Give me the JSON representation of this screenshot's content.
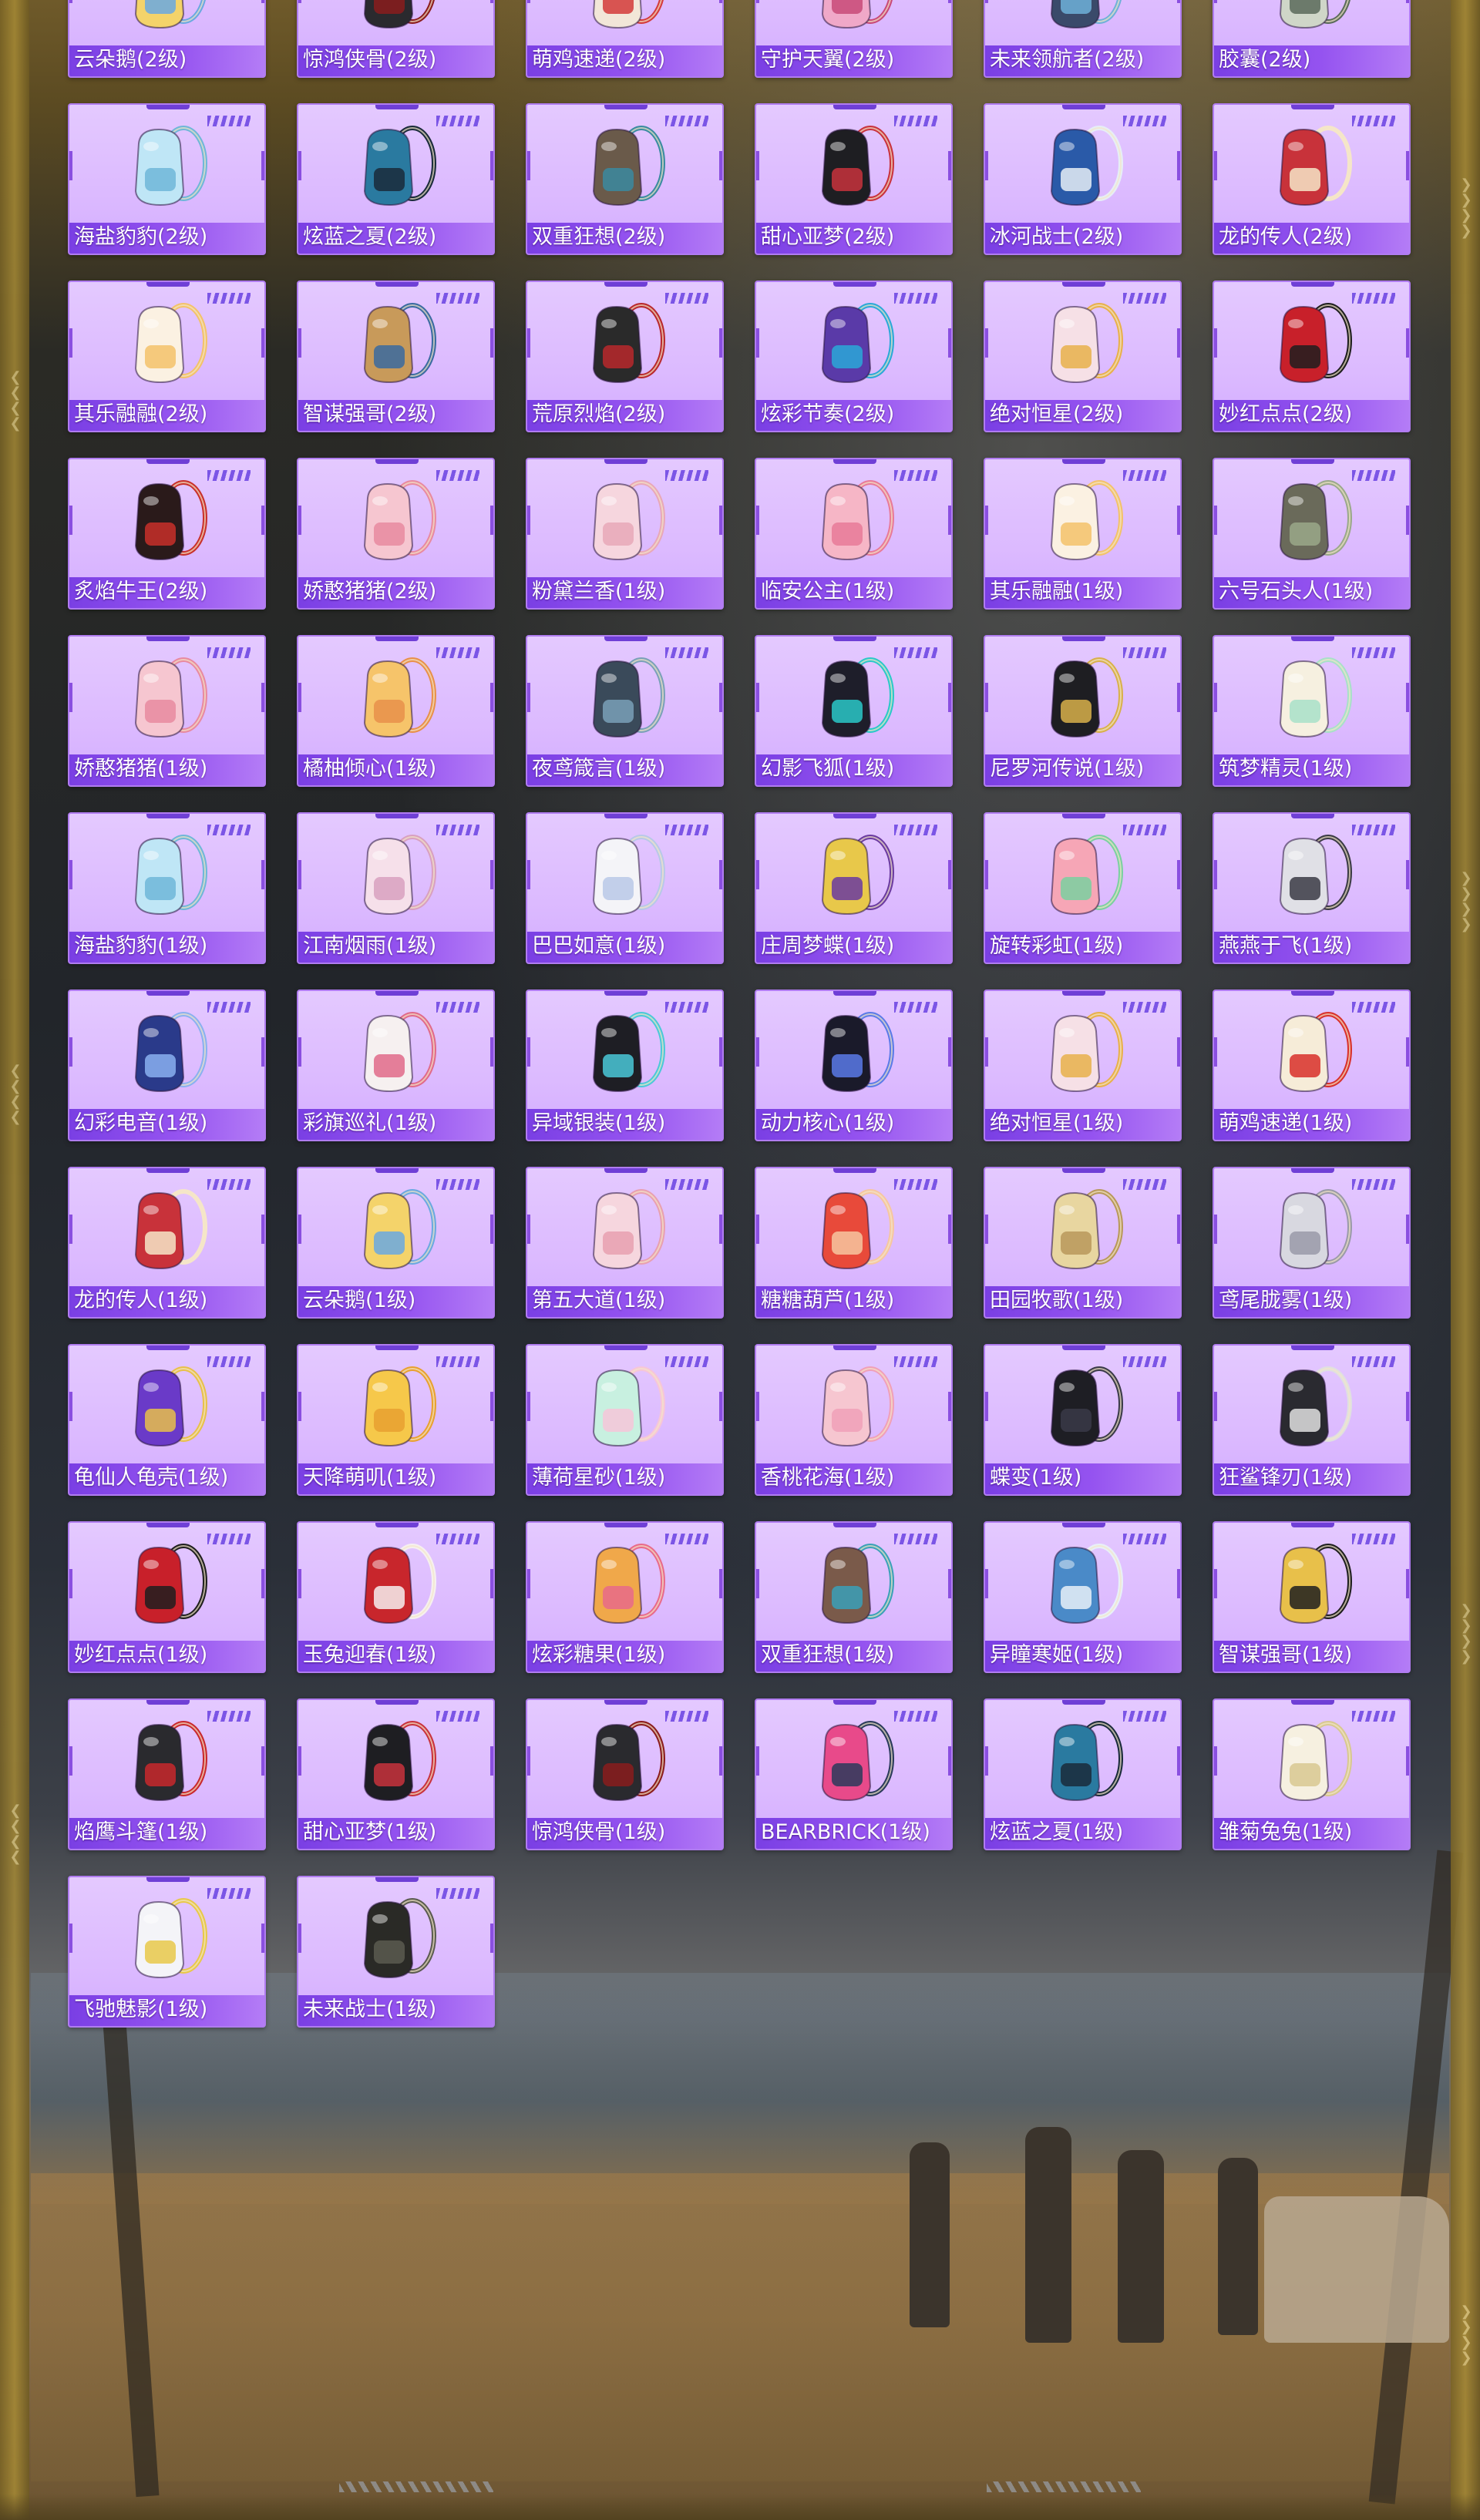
{
  "items": [
    {
      "name": "云朵鹅(2级)",
      "icon": "backpack-icon",
      "colors": [
        "#f4d36a",
        "#6aa8e0"
      ]
    },
    {
      "name": "惊鸿侠骨(2级)",
      "icon": "backpack-icon",
      "colors": [
        "#2a2a2e",
        "#8a1c1c"
      ]
    },
    {
      "name": "萌鸡速递(2级)",
      "icon": "backpack-icon",
      "colors": [
        "#f2e6d8",
        "#d33a3a"
      ]
    },
    {
      "name": "守护天翼(2级)",
      "icon": "backpack-icon",
      "colors": [
        "#f0a8c8",
        "#c84a78"
      ]
    },
    {
      "name": "未来领航者(2级)",
      "icon": "backpack-icon",
      "colors": [
        "#3a4a6a",
        "#6fb0d8"
      ]
    },
    {
      "name": "胶囊(2级)",
      "icon": "backpack-icon",
      "colors": [
        "#cfd6c8",
        "#5a6a5a"
      ]
    },
    {
      "name": "海盐豹豹(2级)",
      "icon": "backpack-icon",
      "colors": [
        "#bfe6f6",
        "#6fb6d8"
      ]
    },
    {
      "name": "炫蓝之夏(2级)",
      "icon": "backpack-icon",
      "colors": [
        "#2a7aa0",
        "#1a2a3a"
      ]
    },
    {
      "name": "双重狂想(2级)",
      "icon": "backpack-icon",
      "colors": [
        "#6a5a4a",
        "#3a8aa0"
      ]
    },
    {
      "name": "甜心亚梦(2级)",
      "icon": "backpack-icon",
      "colors": [
        "#1e1e22",
        "#c8323c"
      ]
    },
    {
      "name": "冰河战士(2级)",
      "icon": "backpack-icon",
      "colors": [
        "#2a5aa8",
        "#e6eef6"
      ]
    },
    {
      "name": "龙的传人(2级)",
      "icon": "backpack-icon",
      "colors": [
        "#c8323a",
        "#f6e6c8"
      ]
    },
    {
      "name": "其乐融融(2级)",
      "icon": "backpack-icon",
      "colors": [
        "#fbf1e2",
        "#f3c26a"
      ]
    },
    {
      "name": "智谋强哥(2级)",
      "icon": "backpack-icon",
      "colors": [
        "#c89a5a",
        "#3a6aa0"
      ]
    },
    {
      "name": "荒原烈焰(2级)",
      "icon": "backpack-icon",
      "colors": [
        "#2a2a2a",
        "#b8282c"
      ]
    },
    {
      "name": "炫彩节奏(2级)",
      "icon": "backpack-icon",
      "colors": [
        "#5a3aa8",
        "#2aa8d8"
      ]
    },
    {
      "name": "绝对恒星(2级)",
      "icon": "backpack-icon",
      "colors": [
        "#f6e0e6",
        "#e8b04a"
      ]
    },
    {
      "name": "妙红点点(2级)",
      "icon": "backpack-icon",
      "colors": [
        "#c8202a",
        "#1e1e1e"
      ]
    },
    {
      "name": "炙焰牛王(2级)",
      "icon": "backpack-icon",
      "colors": [
        "#2a1a1a",
        "#c8302a"
      ]
    },
    {
      "name": "娇憨猪猪(2级)",
      "icon": "backpack-icon",
      "colors": [
        "#f6c6d0",
        "#e88aa0"
      ]
    },
    {
      "name": "粉黛兰香(1级)",
      "icon": "backpack-icon",
      "colors": [
        "#f6d6de",
        "#e8a8b8"
      ]
    },
    {
      "name": "临安公主(1级)",
      "icon": "backpack-icon",
      "colors": [
        "#f6b6c6",
        "#e87a98"
      ]
    },
    {
      "name": "其乐融融(1级)",
      "icon": "backpack-icon",
      "colors": [
        "#fbf1e2",
        "#f3c26a"
      ]
    },
    {
      "name": "六号石头人(1级)",
      "icon": "backpack-icon",
      "colors": [
        "#6a6a5a",
        "#9aa88a"
      ]
    },
    {
      "name": "娇憨猪猪(1级)",
      "icon": "backpack-icon",
      "colors": [
        "#f6c6d0",
        "#e88aa0"
      ]
    },
    {
      "name": "橘柚倾心(1级)",
      "icon": "backpack-icon",
      "colors": [
        "#f6c46a",
        "#e8904a"
      ]
    },
    {
      "name": "夜鸢箴言(1级)",
      "icon": "backpack-icon",
      "colors": [
        "#3a4a5a",
        "#7aa0b8"
      ]
    },
    {
      "name": "幻影飞狐(1级)",
      "icon": "backpack-icon",
      "colors": [
        "#1e1e2a",
        "#2ac8c8"
      ]
    },
    {
      "name": "尼罗河传说(1级)",
      "icon": "backpack-icon",
      "colors": [
        "#1e1e22",
        "#d8b04a"
      ]
    },
    {
      "name": "筑梦精灵(1级)",
      "icon": "backpack-icon",
      "colors": [
        "#f6f0e0",
        "#a8e0c8"
      ]
    },
    {
      "name": "海盐豹豹(1级)",
      "icon": "backpack-icon",
      "colors": [
        "#bfe6f6",
        "#6fb6d8"
      ]
    },
    {
      "name": "江南烟雨(1级)",
      "icon": "backpack-icon",
      "colors": [
        "#f6e0ea",
        "#d8a0c0"
      ]
    },
    {
      "name": "巴巴如意(1级)",
      "icon": "backpack-icon",
      "colors": [
        "#f4f4f8",
        "#b8c8e8"
      ]
    },
    {
      "name": "庄周梦蝶(1级)",
      "icon": "backpack-icon",
      "colors": [
        "#e8c84a",
        "#6a3aa0"
      ]
    },
    {
      "name": "旋转彩虹(1级)",
      "icon": "backpack-icon",
      "colors": [
        "#f6a6b6",
        "#7ad0a0"
      ]
    },
    {
      "name": "燕燕于飞(1级)",
      "icon": "backpack-icon",
      "colors": [
        "#e0e0e6",
        "#3a3a44"
      ]
    },
    {
      "name": "幻彩电音(1级)",
      "icon": "backpack-icon",
      "colors": [
        "#2a3a8a",
        "#8ab0f0"
      ]
    },
    {
      "name": "彩旗巡礼(1级)",
      "icon": "backpack-icon",
      "colors": [
        "#f6f0f0",
        "#e06a8a"
      ]
    },
    {
      "name": "异域银装(1级)",
      "icon": "backpack-icon",
      "colors": [
        "#1e1e24",
        "#4ac8d8"
      ]
    },
    {
      "name": "动力核心(1级)",
      "icon": "backpack-icon",
      "colors": [
        "#1a1a2a",
        "#5a7ae8"
      ]
    },
    {
      "name": "绝对恒星(1级)",
      "icon": "backpack-icon",
      "colors": [
        "#f6e0e6",
        "#e8b04a"
      ]
    },
    {
      "name": "萌鸡速递(1级)",
      "icon": "backpack-icon",
      "colors": [
        "#f6ecd8",
        "#d8302a"
      ]
    },
    {
      "name": "龙的传人(1级)",
      "icon": "backpack-icon",
      "colors": [
        "#c8323a",
        "#f6e6c8"
      ]
    },
    {
      "name": "云朵鹅(1级)",
      "icon": "backpack-icon",
      "colors": [
        "#f4d36a",
        "#6aa8e0"
      ]
    },
    {
      "name": "第五大道(1级)",
      "icon": "backpack-icon",
      "colors": [
        "#f6d6de",
        "#e8a0b0"
      ]
    },
    {
      "name": "糖糖葫芦(1级)",
      "icon": "backpack-icon",
      "colors": [
        "#e84a3a",
        "#f6c6a0"
      ]
    },
    {
      "name": "田园牧歌(1级)",
      "icon": "backpack-icon",
      "colors": [
        "#e8d6a0",
        "#b8985a"
      ]
    },
    {
      "name": "鸢尾胧雾(1级)",
      "icon": "backpack-icon",
      "colors": [
        "#d8d8e0",
        "#9a9aa8"
      ]
    },
    {
      "name": "龟仙人龟壳(1级)",
      "icon": "backpack-icon",
      "colors": [
        "#6a3ac8",
        "#e8c04a"
      ]
    },
    {
      "name": "天降萌叽(1级)",
      "icon": "backpack-icon",
      "colors": [
        "#f6c84a",
        "#e8a030"
      ]
    },
    {
      "name": "薄荷星砂(1级)",
      "icon": "backpack-icon",
      "colors": [
        "#c8f0e0",
        "#f6c6d8"
      ]
    },
    {
      "name": "香桃花海(1级)",
      "icon": "backpack-icon",
      "colors": [
        "#f6c6d0",
        "#f0a0b8"
      ]
    },
    {
      "name": "蝶变(1级)",
      "icon": "backpack-icon",
      "colors": [
        "#1e1e24",
        "#3a3a48"
      ]
    },
    {
      "name": "狂鲨锋刃(1级)",
      "icon": "backpack-icon",
      "colors": [
        "#2a2a30",
        "#e0e0e0"
      ]
    },
    {
      "name": "妙红点点(1级)",
      "icon": "backpack-icon",
      "colors": [
        "#c8202a",
        "#1e1e1e"
      ]
    },
    {
      "name": "玉兔迎春(1级)",
      "icon": "backpack-icon",
      "colors": [
        "#c8262c",
        "#f6f0f0"
      ]
    },
    {
      "name": "炫彩糖果(1级)",
      "icon": "backpack-icon",
      "colors": [
        "#f0a84a",
        "#e86a8a"
      ]
    },
    {
      "name": "双重狂想(1级)",
      "icon": "backpack-icon",
      "colors": [
        "#7a5a4a",
        "#3aa0b8"
      ]
    },
    {
      "name": "异瞳寒姬(1级)",
      "icon": "backpack-icon",
      "colors": [
        "#4a8ac8",
        "#e8f0f8"
      ]
    },
    {
      "name": "智谋强哥(1级)",
      "icon": "backpack-icon",
      "colors": [
        "#e8c04a",
        "#1e1e1e"
      ]
    },
    {
      "name": "焰鹰斗篷(1级)",
      "icon": "backpack-icon",
      "colors": [
        "#2a2a2e",
        "#c8282c"
      ]
    },
    {
      "name": "甜心亚梦(1级)",
      "icon": "backpack-icon",
      "colors": [
        "#1e1e22",
        "#c8323c"
      ]
    },
    {
      "name": "惊鸿侠骨(1级)",
      "icon": "backpack-icon",
      "colors": [
        "#2a2a2e",
        "#8a1c1c"
      ]
    },
    {
      "name": "BEARBRICK(1级)",
      "icon": "backpack-icon",
      "colors": [
        "#e84a8a",
        "#2a3a5a"
      ]
    },
    {
      "name": "炫蓝之夏(1级)",
      "icon": "backpack-icon",
      "colors": [
        "#2a7aa0",
        "#1a2a3a"
      ]
    },
    {
      "name": "雏菊兔兔(1级)",
      "icon": "backpack-icon",
      "colors": [
        "#f6f0e0",
        "#d8c890"
      ]
    },
    {
      "name": "飞驰魅影(1级)",
      "icon": "backpack-icon",
      "colors": [
        "#f4f4f8",
        "#e8c84a"
      ]
    },
    {
      "name": "未来战士(1级)",
      "icon": "backpack-icon",
      "colors": [
        "#2a2a26",
        "#5a5a50"
      ]
    }
  ],
  "theme": {
    "card_bg": "#dcbaff",
    "card_border": "#b07cf0",
    "name_bar": "#8a4fe0",
    "frame_gold": "#a68a35"
  }
}
